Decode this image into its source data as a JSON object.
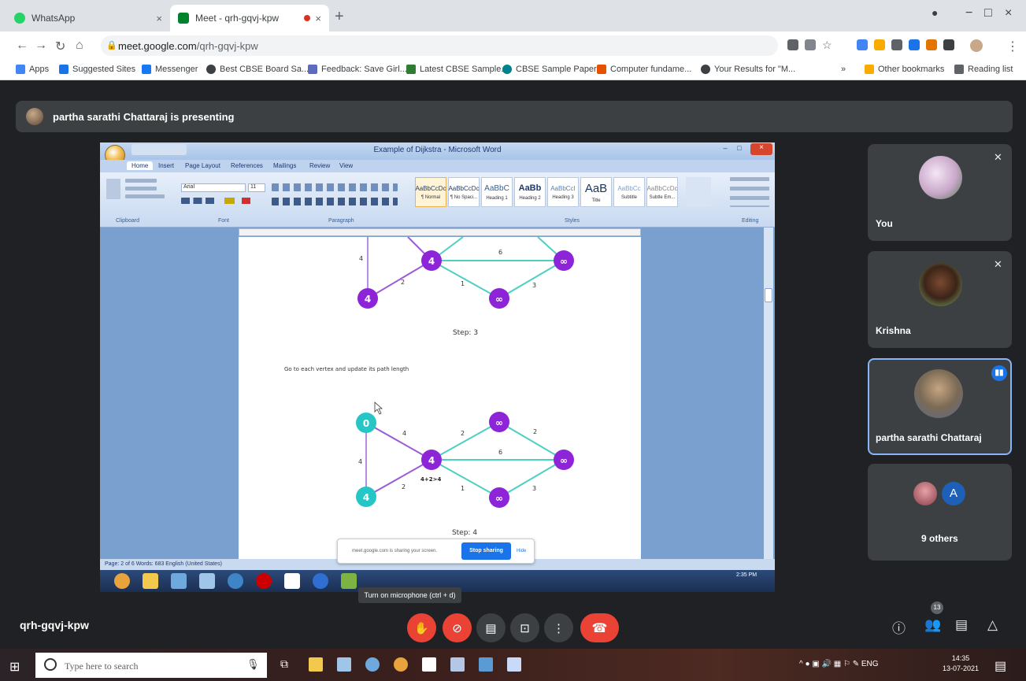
{
  "browser": {
    "tabs": [
      {
        "title": "WhatsApp",
        "close": "×",
        "active": false,
        "favicon_color": "#25d366"
      },
      {
        "title": "Meet - qrh-gqvj-kpw",
        "close": "×",
        "active": true,
        "favicon_color": "#00832d"
      }
    ],
    "new_tab": "+",
    "window_controls": {
      "minimize": "−",
      "maximize": "□",
      "close": "×"
    },
    "url_host": "meet.google.com",
    "url_path": "/qrh-gqvj-kpw",
    "bookmarks": [
      {
        "label": "Apps",
        "color": "#4285f4"
      },
      {
        "label": "Suggested Sites",
        "color": "#1a73e8"
      },
      {
        "label": "Messenger",
        "color": "#1877f2"
      },
      {
        "label": "Best CBSE Board Sa...",
        "color": "#3c4043"
      },
      {
        "label": "Feedback: Save Girl...",
        "color": "#5c6bc0"
      },
      {
        "label": "Latest CBSE Sample...",
        "color": "#2e7d32"
      },
      {
        "label": "CBSE Sample Paper...",
        "color": "#00838f"
      },
      {
        "label": "Computer fundame...",
        "color": "#e65100"
      },
      {
        "label": "Your Results for \"M...",
        "color": "#3c4043"
      }
    ],
    "bookmarks_right": [
      {
        "label": "Other bookmarks",
        "color": "#f9ab00"
      },
      {
        "label": "Reading list",
        "color": "#5f6368"
      }
    ]
  },
  "meet": {
    "presenting_text": "partha sarathi Chattaraj is presenting",
    "meeting_code": "qrh-gqvj-kpw",
    "participants": [
      {
        "name": "You",
        "muted": true
      },
      {
        "name": "Krishna",
        "muted": true
      },
      {
        "name": "partha sarathi Chattaraj",
        "speaking": true
      },
      {
        "name": "9 others",
        "initial": "A"
      }
    ],
    "participant_count": "13",
    "tooltip": "Turn on microphone (ctrl + d)",
    "share_banner": {
      "text": "meet.google.com is sharing your screen.",
      "stop_label": "Stop sharing",
      "hide_label": "Hide"
    }
  },
  "word": {
    "title": "Example of Dijkstra - Microsoft Word",
    "tabs": [
      "Home",
      "Insert",
      "Page Layout",
      "References",
      "Mailings",
      "Review",
      "View"
    ],
    "font_name": "Arial",
    "font_size": "11",
    "styles": [
      {
        "sample": "AaBbCcDc",
        "name": "¶ Normal",
        "selected": true
      },
      {
        "sample": "AaBbCcDc",
        "name": "¶ No Spaci..."
      },
      {
        "sample": "AaBbC",
        "name": "Heading 1"
      },
      {
        "sample": "AaBb",
        "name": "Heading 2"
      },
      {
        "sample": "AaBbCcI",
        "name": "Heading 3"
      },
      {
        "sample": "AaB",
        "name": "Title"
      },
      {
        "sample": "AaBbCc",
        "name": "Subtitle"
      },
      {
        "sample": "AaBbCcDc",
        "name": "Subtle Em..."
      }
    ],
    "groups": [
      "Clipboard",
      "Font",
      "Paragraph",
      "Styles",
      "Editing"
    ],
    "status": "Page: 2 of 6   Words: 683   English (United States)",
    "content": {
      "graph1": {
        "nodes": [
          {
            "label": "4",
            "color": "#8e24d8"
          },
          {
            "label": "4",
            "color": "#8e24d8"
          },
          {
            "label": "∞",
            "color": "#8e24d8"
          },
          {
            "label": "∞",
            "color": "#8e24d8"
          }
        ],
        "edge_labels": [
          "4",
          "6",
          "2",
          "1",
          "3"
        ],
        "caption": "Step: 3"
      },
      "paragraph": "Go to each vertex and update its path length",
      "graph2": {
        "nodes": [
          {
            "label": "0",
            "color": "#26c6c6"
          },
          {
            "label": "∞",
            "color": "#8e24d8"
          },
          {
            "label": "4",
            "color": "#8e24d8"
          },
          {
            "label": "∞",
            "color": "#8e24d8"
          },
          {
            "label": "4",
            "color": "#26c6c6"
          },
          {
            "label": "∞",
            "color": "#8e24d8"
          }
        ],
        "edge_labels": [
          "4",
          "2",
          "2",
          "4",
          "6",
          "2",
          "1",
          "3"
        ],
        "annotation": "4+2>4",
        "caption": "Step: 4"
      }
    },
    "taskbar_clock": "2:35 PM"
  },
  "windows": {
    "search_placeholder": "Type here to search",
    "language": "ENG",
    "time": "14:35",
    "date": "13-07-2021"
  }
}
